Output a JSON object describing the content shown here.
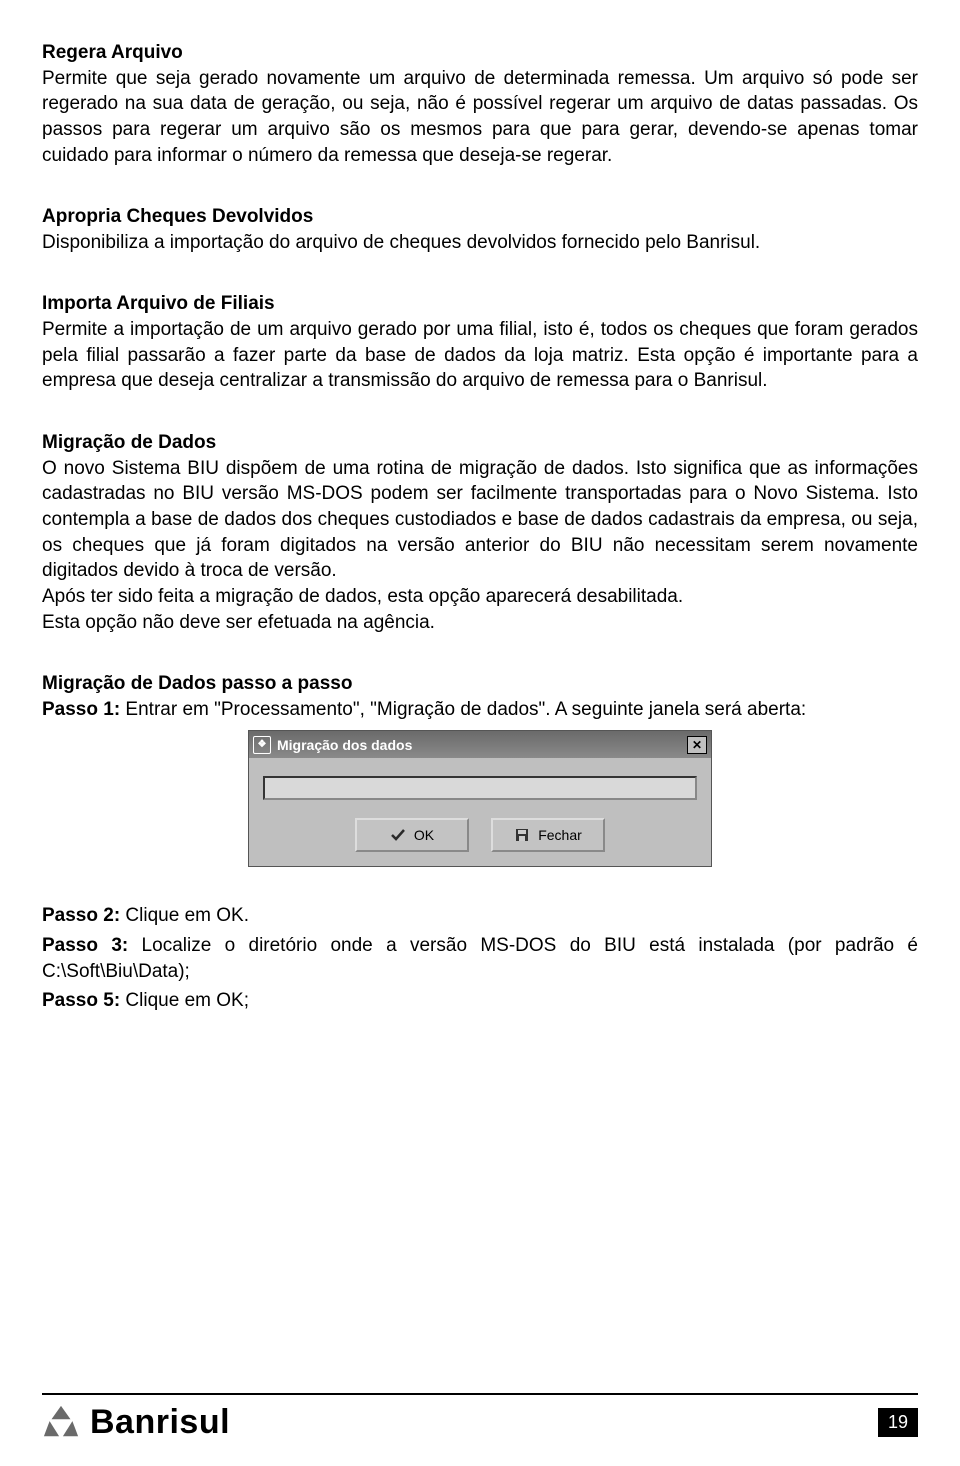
{
  "sections": [
    {
      "title": "Regera Arquivo",
      "body": "Permite que seja gerado novamente um arquivo de determinada remessa. Um arquivo só pode ser regerado na sua data de geração, ou seja, não é possível regerar um arquivo de datas passadas. Os passos para regerar um arquivo são os mesmos para que para gerar, devendo-se apenas tomar cuidado para informar o número da remessa que deseja-se regerar."
    },
    {
      "title": "Apropria Cheques Devolvidos",
      "body": "Disponibiliza a importação do arquivo de cheques devolvidos fornecido pelo Banrisul."
    },
    {
      "title": "Importa Arquivo de Filiais",
      "body": "Permite a importação de um arquivo gerado por uma filial, isto é, todos os cheques que foram gerados pela filial passarão a fazer parte da base de dados da loja matriz. Esta opção é importante para a empresa que deseja centralizar a transmissão do arquivo de remessa para o Banrisul."
    },
    {
      "title": "Migração de Dados",
      "body": "O novo Sistema BIU dispõem de uma rotina de migração de dados. Isto significa que as informações cadastradas no BIU versão MS-DOS podem ser facilmente transportadas para o Novo Sistema. Isto contempla a base de dados dos cheques custodiados e base de dados cadastrais da empresa, ou seja, os cheques que já foram digitados na versão anterior do BIU não necessitam serem novamente digitados devido à troca de versão.",
      "extra1": "Após ter sido feita a migração de dados, esta opção aparecerá desabilitada.",
      "extra2": "Esta opção não deve ser efetuada na agência."
    }
  ],
  "stepsTitle": "Migração de Dados passo a passo",
  "step1": {
    "lead": "Passo 1:",
    "text": " Entrar em \"Processamento\", \"Migração de dados\". A seguinte janela será aberta:"
  },
  "dialog": {
    "title": "Migração dos dados",
    "ok": "OK",
    "close": "Fechar"
  },
  "step2": {
    "lead": "Passo 2:",
    "text": " Clique em OK."
  },
  "step3": {
    "lead": "Passo 3:",
    "text": " Localize o diretório onde a versão MS-DOS do BIU está instalada (por padrão é C:\\Soft\\Biu\\Data);"
  },
  "step5": {
    "lead": "Passo 5:",
    "text": " Clique em OK;"
  },
  "brand": "Banrisul",
  "pageNumber": "19"
}
